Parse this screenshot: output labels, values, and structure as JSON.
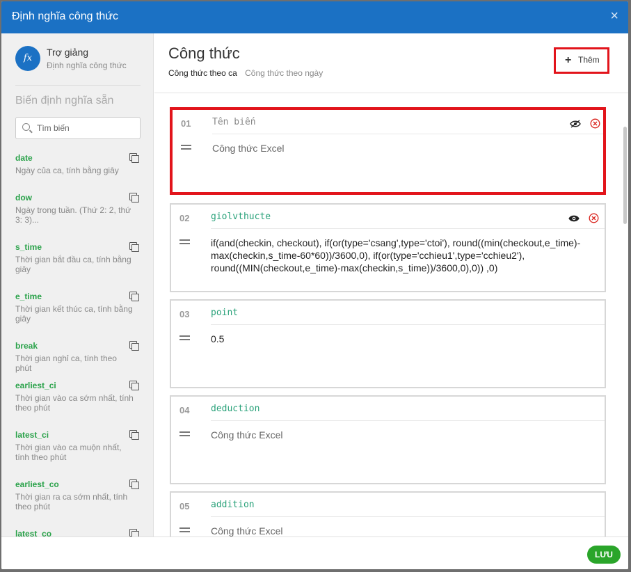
{
  "dialog": {
    "title": "Định nghĩa công thức",
    "close_label": "×"
  },
  "sidebar": {
    "icon_text": "fx",
    "title": "Trợ giảng",
    "subtitle": "Định nghĩa công thức",
    "section_label": "Biến định nghĩa sẵn",
    "search_placeholder": "Tìm biến",
    "variables": [
      {
        "name": "date",
        "desc": "Ngày của ca, tính bằng giây"
      },
      {
        "name": "dow",
        "desc": "Ngày trong tuần. (Thứ 2: 2, thứ 3: 3)..."
      },
      {
        "name": "s_time",
        "desc": "Thời gian bắt đầu ca, tính bằng giây"
      },
      {
        "name": "e_time",
        "desc": "Thời gian kết thúc ca, tính bằng giây"
      },
      {
        "name": "break",
        "desc": "Thời gian nghỉ ca, tính theo phút"
      },
      {
        "name": "earliest_ci",
        "desc": "Thời gian vào ca sớm nhất, tính theo phút"
      },
      {
        "name": "latest_ci",
        "desc": "Thời gian vào ca muộn nhất, tính theo phút"
      },
      {
        "name": "earliest_co",
        "desc": "Thời gian ra ca sớm nhất, tính theo phút"
      },
      {
        "name": "latest_co",
        "desc": ""
      }
    ]
  },
  "main": {
    "title": "Công thức",
    "tabs": [
      {
        "label": "Công thức theo ca",
        "active": true
      },
      {
        "label": "Công thức theo ngày",
        "active": false
      }
    ],
    "add_button": {
      "icon": "+",
      "label": "Thêm"
    },
    "formulas": [
      {
        "num": "01",
        "name": "Tên biến",
        "formula": "Công thức Excel",
        "name_is_placeholder": true,
        "formula_is_placeholder": true,
        "visibility": "hidden"
      },
      {
        "num": "02",
        "name": "giolvthucte",
        "formula": "if(and(checkin, checkout), if(or(type='csang',type='ctoi'), round((min(checkout,e_time)-max(checkin,s_time-60*60))/3600,0), if(or(type='cchieu1',type='cchieu2'), round((MIN(checkout,e_time)-max(checkin,s_time))/3600,0),0)) ,0)",
        "visibility": "visible"
      },
      {
        "num": "03",
        "name": "point",
        "formula": "0.5"
      },
      {
        "num": "04",
        "name": "deduction",
        "formula": "Công thức Excel",
        "formula_is_placeholder": true
      },
      {
        "num": "05",
        "name": "addition",
        "formula": "Công thức Excel",
        "formula_is_placeholder": true
      }
    ]
  },
  "footer": {
    "save_label": "LƯU"
  },
  "colors": {
    "header_blue": "#1b71c4",
    "variable_green": "#2aa24a",
    "name_teal": "#2aa27a",
    "highlight_red": "#e2141b",
    "save_green": "#2aa52a"
  }
}
